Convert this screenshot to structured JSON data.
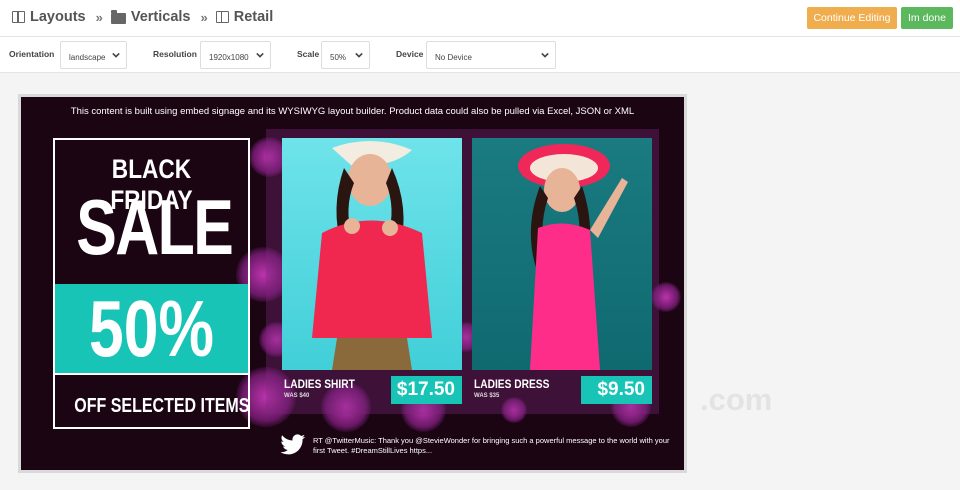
{
  "breadcrumb": {
    "items": [
      {
        "label": "Layouts",
        "icon": "layout-icon"
      },
      {
        "label": "Verticals",
        "icon": "folder-icon"
      },
      {
        "label": "Retail",
        "icon": "layout-icon"
      }
    ],
    "separator": "»"
  },
  "actions": {
    "continue_label": "Continue Editing",
    "done_label": "Im done",
    "continue_color": "#f0ad4e",
    "done_color": "#5cb85c"
  },
  "settings": {
    "orientation": {
      "label": "Orientation",
      "value": "landscape"
    },
    "resolution": {
      "label": "Resolution",
      "value": "1920x1080"
    },
    "scale": {
      "label": "Scale",
      "value": "50%"
    },
    "device": {
      "label": "Device",
      "value": "No Device"
    }
  },
  "preview": {
    "headline": "This content is built using embed signage and its WYSIWYG layout builder. Product data could also be pulled via Excel, JSON or XML",
    "promo": {
      "line1": "BLACK FRIDAY",
      "line2": "SALE",
      "percent": "50%",
      "line3": "OFF SELECTED ITEMS",
      "accent_color": "#17c4b6"
    },
    "products": [
      {
        "name": "LADIES SHIRT",
        "was": "WAS $40",
        "price": "$17.50"
      },
      {
        "name": "LADIES DRESS",
        "was": "WAS $35",
        "price": "$9.50"
      }
    ],
    "tweet": "RT @TwitterMusic: Thank you @StevieWonder for bringing such a powerful message to the world with your first Tweet. #DreamStillLives https..."
  },
  "watermark": ".com"
}
